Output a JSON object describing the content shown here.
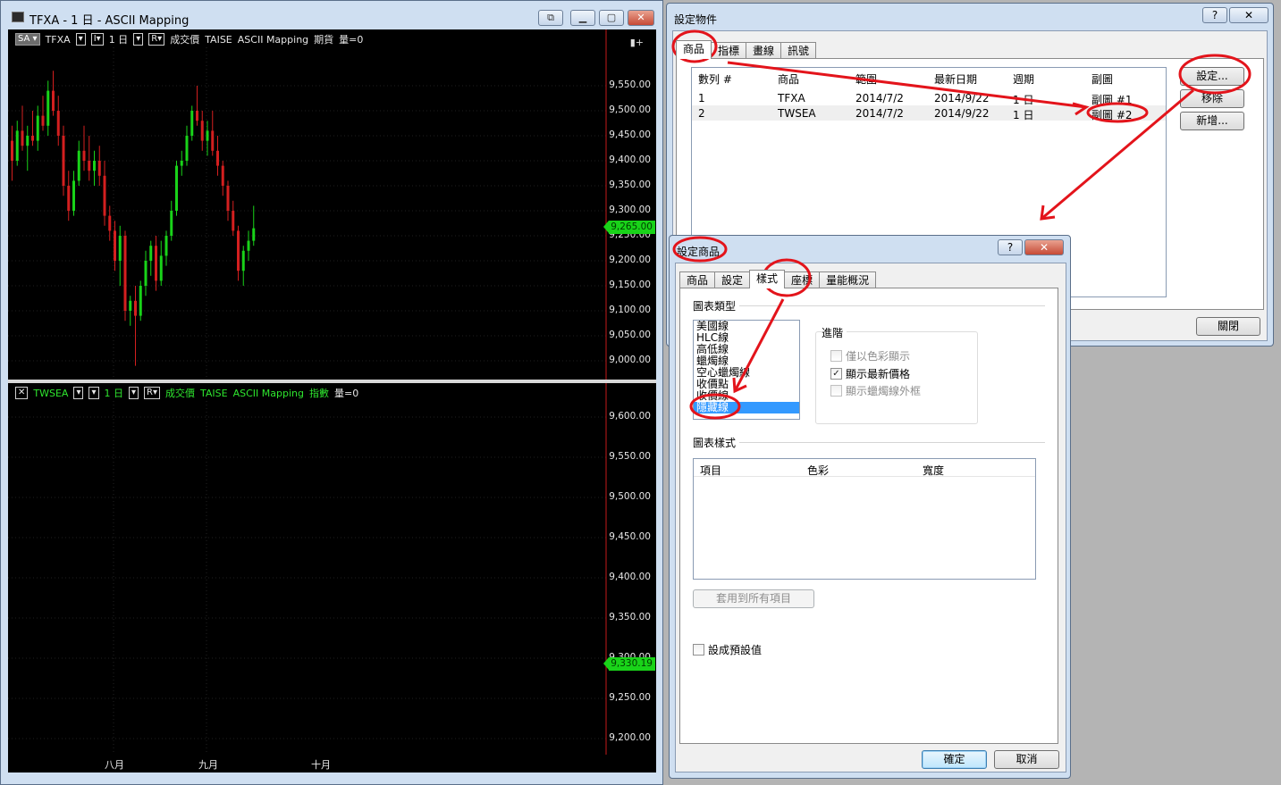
{
  "main_window": {
    "title": "TFXA - 1 日 - ASCII Mapping",
    "top_pane": {
      "header": {
        "sa": "SA",
        "symbol": "TFXA",
        "interval": "1 日",
        "field": "成交價",
        "exchange": "TAISE",
        "source": "ASCII Mapping",
        "type": "期貨",
        "volume": "量=0"
      },
      "y_ticks": [
        "9,550.00",
        "9,500.00",
        "9,450.00",
        "9,400.00",
        "9,350.00",
        "9,300.00",
        "9,250.00",
        "9,200.00",
        "9,150.00",
        "9,100.00",
        "9,050.00",
        "9,000.00"
      ],
      "last_price": "9,265.00"
    },
    "bottom_pane": {
      "header": {
        "symbol": "TWSEA",
        "interval": "1 日",
        "field": "成交價",
        "exchange": "TAISE",
        "source": "ASCII Mapping",
        "type": "指數",
        "volume": "量=0"
      },
      "y_ticks": [
        "9,600.00",
        "9,550.00",
        "9,500.00",
        "9,450.00",
        "9,400.00",
        "9,350.00",
        "9,300.00",
        "9,250.00",
        "9,200.00"
      ],
      "last_price": "9,330.19"
    },
    "date_axis": [
      "八月",
      "九月",
      "十月"
    ]
  },
  "dialog_objects": {
    "title": "設定物件",
    "help": "?",
    "close": "✕",
    "tabs": [
      "商品",
      "指標",
      "畫線",
      "訊號"
    ],
    "columns": [
      "數列 #",
      "商品",
      "範圍",
      "最新日期",
      "週期",
      "副圖"
    ],
    "rows": [
      {
        "no": "1",
        "symbol": "TFXA",
        "range": "2014/7/2",
        "latest": "2014/9/22",
        "period": "1 日",
        "subchart": "副圖 #1"
      },
      {
        "no": "2",
        "symbol": "TWSEA",
        "range": "2014/7/2",
        "latest": "2014/9/22",
        "period": "1 日",
        "subchart": "副圖 #2"
      }
    ],
    "buttons": {
      "settings": "設定...",
      "remove": "移除",
      "add": "新增...",
      "close": "關閉"
    }
  },
  "dialog_symbol": {
    "title": "設定商品",
    "help": "?",
    "close": "✕",
    "tabs": [
      "商品",
      "設定",
      "樣式",
      "座標",
      "量能概況"
    ],
    "chart_type_label": "圖表類型",
    "chart_types": [
      "美國線",
      "HLC線",
      "高低線",
      "蠟燭線",
      "空心蠟燭線",
      "收價點",
      "收價線",
      "隱藏線"
    ],
    "advanced_label": "進階",
    "options": [
      {
        "label": "僅以色彩顯示",
        "checked": false,
        "enabled": false
      },
      {
        "label": "顯示最新價格",
        "checked": true,
        "enabled": true
      },
      {
        "label": "顯示蠟燭線外框",
        "checked": false,
        "enabled": false
      }
    ],
    "style_label": "圖表樣式",
    "style_columns": [
      "項目",
      "色彩",
      "寬度"
    ],
    "apply_all": "套用到所有項目",
    "set_default": "設成預設值",
    "ok": "確定",
    "cancel": "取消"
  },
  "colors": {
    "up": "#19d319",
    "down": "#d41f1f",
    "annotation": "#e3141b",
    "selection": "#3399ff"
  },
  "candles": [
    {
      "o": 9440,
      "h": 9470,
      "l": 9360,
      "c": 9400
    },
    {
      "o": 9400,
      "h": 9480,
      "l": 9390,
      "c": 9460
    },
    {
      "o": 9460,
      "h": 9510,
      "l": 9420,
      "c": 9430
    },
    {
      "o": 9430,
      "h": 9470,
      "l": 9380,
      "c": 9450
    },
    {
      "o": 9450,
      "h": 9500,
      "l": 9430,
      "c": 9440
    },
    {
      "o": 9440,
      "h": 9510,
      "l": 9420,
      "c": 9490
    },
    {
      "o": 9490,
      "h": 9530,
      "l": 9460,
      "c": 9470
    },
    {
      "o": 9470,
      "h": 9560,
      "l": 9450,
      "c": 9540
    },
    {
      "o": 9540,
      "h": 9580,
      "l": 9490,
      "c": 9500
    },
    {
      "o": 9500,
      "h": 9530,
      "l": 9430,
      "c": 9450
    },
    {
      "o": 9450,
      "h": 9470,
      "l": 9330,
      "c": 9350
    },
    {
      "o": 9350,
      "h": 9380,
      "l": 9280,
      "c": 9300
    },
    {
      "o": 9300,
      "h": 9380,
      "l": 9290,
      "c": 9360
    },
    {
      "o": 9360,
      "h": 9440,
      "l": 9350,
      "c": 9420
    },
    {
      "o": 9420,
      "h": 9470,
      "l": 9380,
      "c": 9400
    },
    {
      "o": 9400,
      "h": 9450,
      "l": 9360,
      "c": 9380
    },
    {
      "o": 9380,
      "h": 9420,
      "l": 9350,
      "c": 9400
    },
    {
      "o": 9400,
      "h": 9430,
      "l": 9350,
      "c": 9370
    },
    {
      "o": 9370,
      "h": 9400,
      "l": 9270,
      "c": 9290
    },
    {
      "o": 9290,
      "h": 9310,
      "l": 9240,
      "c": 9260
    },
    {
      "o": 9260,
      "h": 9280,
      "l": 9180,
      "c": 9200
    },
    {
      "o": 9200,
      "h": 9270,
      "l": 9150,
      "c": 9250
    },
    {
      "o": 9250,
      "h": 9260,
      "l": 9080,
      "c": 9100
    },
    {
      "o": 9100,
      "h": 9130,
      "l": 9070,
      "c": 9120
    },
    {
      "o": 9120,
      "h": 9150,
      "l": 8990,
      "c": 9090
    },
    {
      "o": 9090,
      "h": 9160,
      "l": 9080,
      "c": 9150
    },
    {
      "o": 9150,
      "h": 9220,
      "l": 9130,
      "c": 9200
    },
    {
      "o": 9200,
      "h": 9240,
      "l": 9170,
      "c": 9230
    },
    {
      "o": 9230,
      "h": 9250,
      "l": 9140,
      "c": 9160
    },
    {
      "o": 9160,
      "h": 9240,
      "l": 9150,
      "c": 9210
    },
    {
      "o": 9210,
      "h": 9260,
      "l": 9190,
      "c": 9250
    },
    {
      "o": 9250,
      "h": 9320,
      "l": 9240,
      "c": 9300
    },
    {
      "o": 9300,
      "h": 9400,
      "l": 9290,
      "c": 9390
    },
    {
      "o": 9390,
      "h": 9420,
      "l": 9370,
      "c": 9400
    },
    {
      "o": 9400,
      "h": 9470,
      "l": 9390,
      "c": 9450
    },
    {
      "o": 9450,
      "h": 9510,
      "l": 9440,
      "c": 9500
    },
    {
      "o": 9500,
      "h": 9550,
      "l": 9470,
      "c": 9480
    },
    {
      "o": 9480,
      "h": 9500,
      "l": 9420,
      "c": 9440
    },
    {
      "o": 9440,
      "h": 9480,
      "l": 9410,
      "c": 9460
    },
    {
      "o": 9460,
      "h": 9500,
      "l": 9410,
      "c": 9420
    },
    {
      "o": 9420,
      "h": 9450,
      "l": 9370,
      "c": 9390
    },
    {
      "o": 9390,
      "h": 9400,
      "l": 9330,
      "c": 9350
    },
    {
      "o": 9350,
      "h": 9360,
      "l": 9280,
      "c": 9300
    },
    {
      "o": 9300,
      "h": 9320,
      "l": 9250,
      "c": 9260
    },
    {
      "o": 9260,
      "h": 9270,
      "l": 9160,
      "c": 9180
    },
    {
      "o": 9180,
      "h": 9230,
      "l": 9150,
      "c": 9220
    },
    {
      "o": 9220,
      "h": 9260,
      "l": 9200,
      "c": 9240
    },
    {
      "o": 9240,
      "h": 9310,
      "l": 9230,
      "c": 9265
    }
  ]
}
